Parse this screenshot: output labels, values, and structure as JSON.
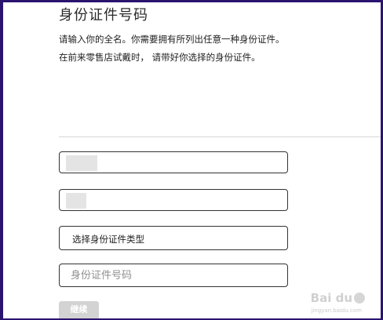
{
  "form": {
    "title": "身份证件号码",
    "description": "请输入你的全名。你需要拥有所列出任意一种身份证件。在前来零售店试戴时， 请带好你选择的身份证件。",
    "id_type_select": "选择身份证件类型",
    "id_number_placeholder": "身份证件号码",
    "continue_label": "继续"
  },
  "watermark": {
    "brand": "Bai du",
    "sub": "jingyan.baidu.com"
  },
  "colors": {
    "border": "#2a1470",
    "field_border": "#333333",
    "button_disabled": "#d3d3d3"
  }
}
